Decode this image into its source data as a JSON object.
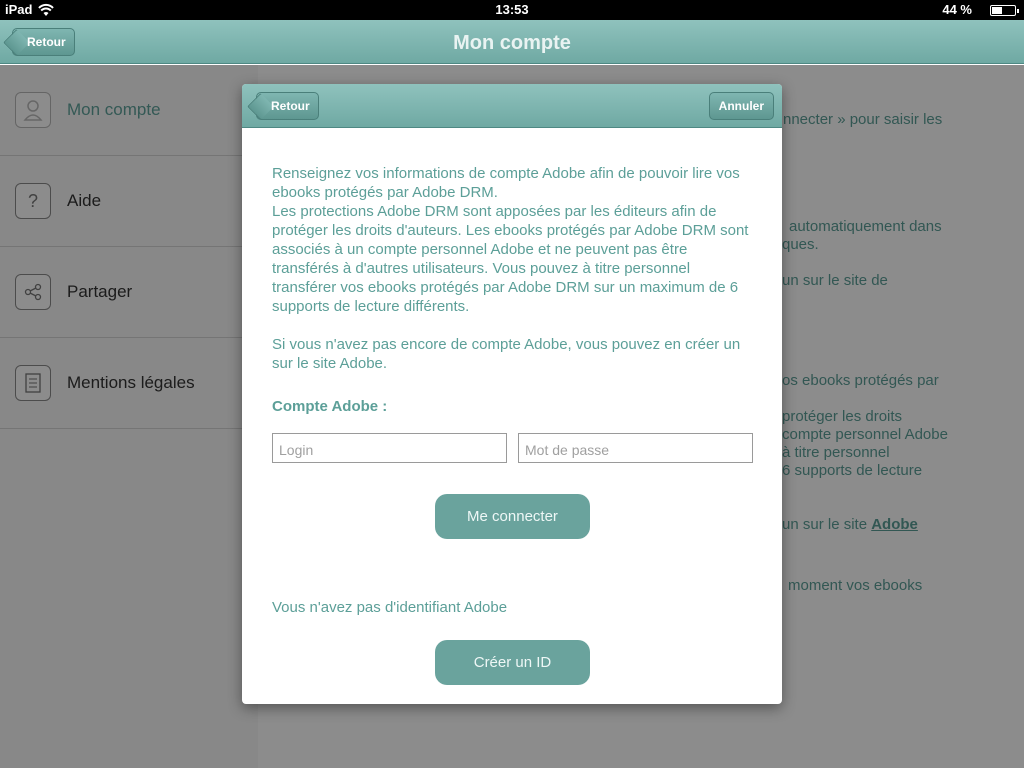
{
  "status_bar": {
    "device": "iPad",
    "time": "13:53",
    "battery": "44 %",
    "battery_level": 0.44
  },
  "nav": {
    "back_label": "Retour",
    "title": "Mon compte"
  },
  "sidebar": {
    "items": [
      {
        "label": "Mon compte",
        "icon": "user-icon"
      },
      {
        "label": "Aide",
        "icon": "help-icon"
      },
      {
        "label": "Partager",
        "icon": "share-icon"
      },
      {
        "label": "Mentions légales",
        "icon": "document-icon"
      }
    ]
  },
  "background": {
    "lines": [
      "nnecter » pour saisir les",
      "automatiquement dans",
      "ques.",
      "un sur le site de",
      "os ebooks protégés par",
      "protéger les droits",
      "compte personnel Adobe",
      "à titre personnel",
      "6 supports de lecture",
      "un sur le site",
      "moment vos ebooks"
    ],
    "link": "Adobe"
  },
  "modal": {
    "back_label": "Retour",
    "cancel_label": "Annuler",
    "paragraph1": "Renseignez vos informations de compte Adobe afin de pouvoir lire vos ebooks protégés par Adobe DRM.",
    "paragraph1b": "Les protections Adobe DRM sont apposées par les éditeurs afin de protéger les droits d'auteurs. Les ebooks protégés par Adobe DRM sont associés à un compte personnel Adobe et ne peuvent pas être transférés à d'autres utilisateurs. Vous pouvez à titre personnel transférer vos ebooks protégés par Adobe DRM sur un maximum de 6 supports de lecture différents.",
    "paragraph2": "Si vous n'avez pas encore de compte Adobe, vous pouvez en créer un sur le site Adobe.",
    "section_label": "Compte Adobe :",
    "login_placeholder": "Login",
    "password_placeholder": "Mot de passe",
    "connect_label": "Me connecter",
    "no_id_text": "Vous n'avez pas d'identifiant Adobe",
    "create_label": "Créer un ID"
  }
}
